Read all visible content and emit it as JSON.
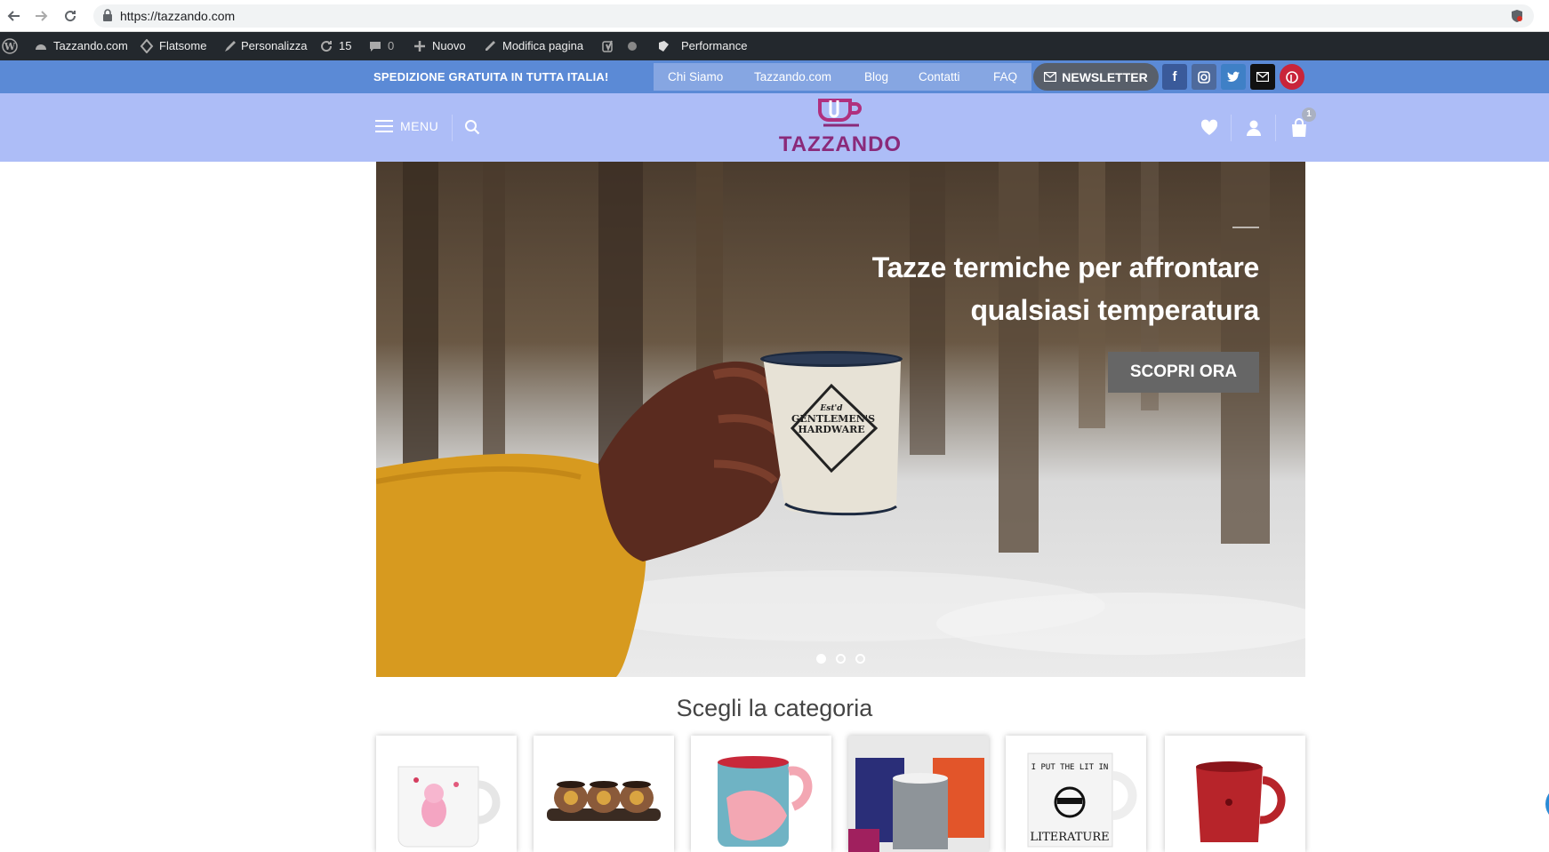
{
  "browser": {
    "url": "https://tazzando.com"
  },
  "admin_bar": {
    "site_name": "Tazzando.com",
    "theme": "Flatsome",
    "customize": "Personalizza",
    "updates": "15",
    "comments": "0",
    "new": "Nuovo",
    "edit_page": "Modifica pagina",
    "performance": "Performance"
  },
  "top_bar": {
    "shipping": "SPEDIZIONE GRATUITA IN TUTTA ITALIA!",
    "links": [
      "Chi Siamo",
      "Tazzando.com",
      "Blog",
      "Contatti",
      "FAQ"
    ],
    "newsletter": "NEWSLETTER",
    "social": [
      "facebook",
      "instagram",
      "twitter",
      "email",
      "pinterest"
    ]
  },
  "header": {
    "menu_label": "MENU",
    "logo_text": "TAZZANDO",
    "cart_count": "1"
  },
  "hero": {
    "title_line1": "Tazze termiche per affrontare",
    "title_line2": "qualsiasi temperatura",
    "cta": "SCOPRI ORA",
    "mug_text": [
      "Est'd",
      "GENTLEMEN'S",
      "HARDWARE"
    ],
    "active_slide": 1,
    "slide_count": 3
  },
  "categories": {
    "title": "Scegli la categoria",
    "mug_label": [
      "I PUT THE LIT IN",
      "LITERATURE"
    ]
  },
  "colors": {
    "top_bar": "#5b8ad6",
    "header": "#adbdf7",
    "logo": "#8a2a7a",
    "admin_bar": "#23282d"
  }
}
